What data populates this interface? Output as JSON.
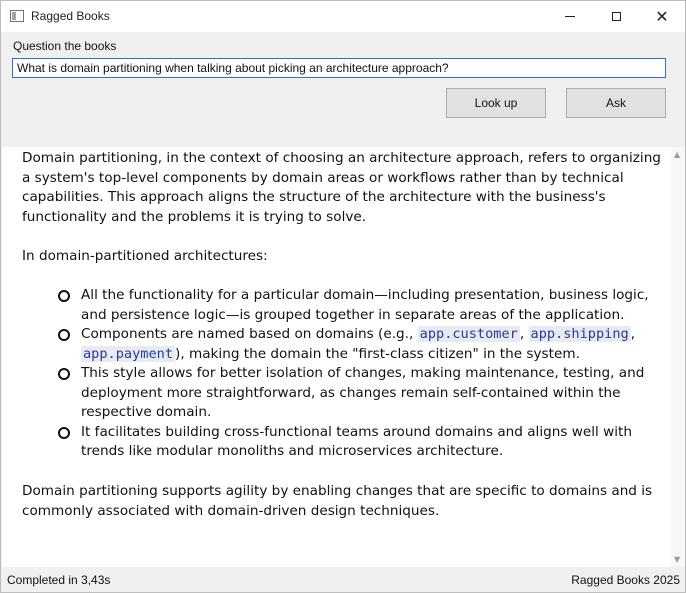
{
  "window": {
    "title": "Ragged Books",
    "close_glyph": "✕"
  },
  "form": {
    "label": "Question the books",
    "question_value": "What is domain partitioning when talking about picking an architecture approach?",
    "lookup_label": "Look up",
    "ask_label": "Ask"
  },
  "answer": {
    "p1": "Domain partitioning, in the context of choosing an architecture approach, refers to organizing a system's top-level components by domain areas or workflows rather than by technical capabilities. This approach aligns the structure of the architecture with the business's functionality and the problems it is trying to solve.",
    "p2": "In domain-partitioned architectures:",
    "bullet1": "All the functionality for a particular domain—including presentation, business logic, and persistence logic—is grouped together in separate areas of the application.",
    "bullet2_before": "Components are named based on domains (e.g., ",
    "code1": "app.customer",
    "sep1": ", ",
    "code2": "app.shipping",
    "sep2": ", ",
    "code3": "app.payment",
    "bullet2_after": "), making the domain the \"first-class citizen\" in the system.",
    "bullet3": "This style allows for better isolation of changes, making maintenance, testing, and deployment more straightforward, as changes remain self-contained within the respective domain.",
    "bullet4": "It facilitates building cross-functional teams around domains and aligns well with trends like modular monoliths and microservices architecture.",
    "p3": "Domain partitioning supports agility by enabling changes that are specific to domains and is commonly associated with domain-driven design techniques."
  },
  "status": {
    "left": "Completed in 3,43s",
    "right": "Ragged Books 2025"
  },
  "colors": {
    "input_border": "#2e6fd6",
    "code_text": "#1c3f9f",
    "code_bg": "#e9e9f0"
  }
}
